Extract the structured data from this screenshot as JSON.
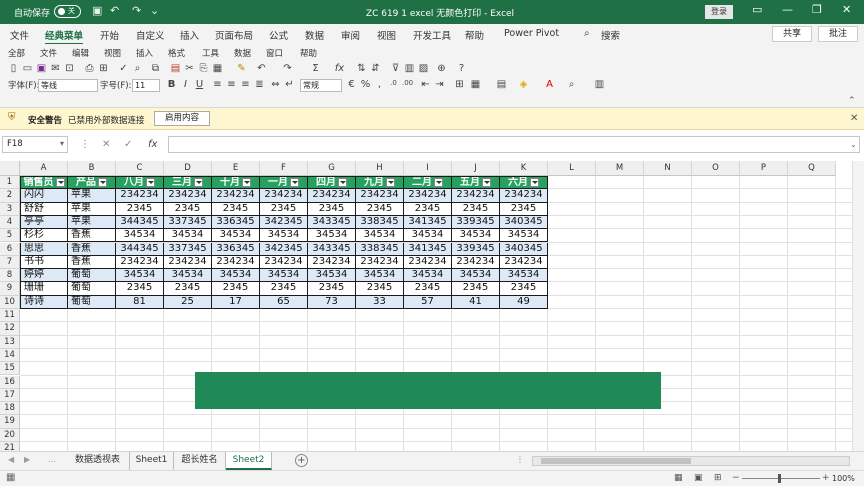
{
  "titlebar": {
    "autosave": "自动保存",
    "autosave_state": "关",
    "title": "ZC 619 1 excel 无颜色打印 - Excel",
    "login": "登录"
  },
  "menubar": {
    "tabs": [
      "文件",
      "经典菜单",
      "开始",
      "自定义",
      "插入",
      "页面布局",
      "公式",
      "数据",
      "审阅",
      "视图",
      "开发工具",
      "帮助",
      "Power Pivot"
    ],
    "search": "搜索",
    "share": "共享",
    "comments": "批注"
  },
  "ribbon": {
    "menus": [
      "全部",
      "文件",
      "编辑",
      "视图",
      "插入",
      "格式",
      "工具",
      "数据",
      "窗口",
      "帮助"
    ],
    "font_label": "字体(F):",
    "font_value": "等线",
    "size_label": "字号(F):",
    "size_value": "11",
    "number_format": "常规"
  },
  "security": {
    "title": "安全警告",
    "message": "已禁用外部数据连接",
    "button": "启用内容"
  },
  "formula_bar": {
    "name_box": "F18",
    "fx": "fx",
    "formula": ""
  },
  "columns": [
    "A",
    "B",
    "C",
    "D",
    "E",
    "F",
    "G",
    "H",
    "I",
    "J",
    "K",
    "L",
    "M",
    "N",
    "O",
    "P",
    "Q"
  ],
  "rows": [
    "1",
    "2",
    "3",
    "4",
    "5",
    "6",
    "7",
    "8",
    "9",
    "10",
    "11",
    "12",
    "13",
    "14",
    "15",
    "16",
    "17",
    "18",
    "19",
    "20",
    "21"
  ],
  "table": {
    "headers": [
      "销售员",
      "产品",
      "八月",
      "三月",
      "十月",
      "一月",
      "四月",
      "九月",
      "二月",
      "五月",
      "六月"
    ],
    "data": [
      [
        "闪闪",
        "苹果",
        "234234",
        "234234",
        "234234",
        "234234",
        "234234",
        "234234",
        "234234",
        "234234",
        "234234"
      ],
      [
        "舒舒",
        "苹果",
        "2345",
        "2345",
        "2345",
        "2345",
        "2345",
        "2345",
        "2345",
        "2345",
        "2345"
      ],
      [
        "亭亭",
        "苹果",
        "344345",
        "337345",
        "336345",
        "342345",
        "343345",
        "338345",
        "341345",
        "339345",
        "340345"
      ],
      [
        "杉杉",
        "香蕉",
        "34534",
        "34534",
        "34534",
        "34534",
        "34534",
        "34534",
        "34534",
        "34534",
        "34534"
      ],
      [
        "思思",
        "香蕉",
        "344345",
        "337345",
        "336345",
        "342345",
        "343345",
        "338345",
        "341345",
        "339345",
        "340345"
      ],
      [
        "书书",
        "香蕉",
        "234234",
        "234234",
        "234234",
        "234234",
        "234234",
        "234234",
        "234234",
        "234234",
        "234234"
      ],
      [
        "婷婷",
        "葡萄",
        "34534",
        "34534",
        "34534",
        "34534",
        "34534",
        "34534",
        "34534",
        "34534",
        "34534"
      ],
      [
        "珊珊",
        "葡萄",
        "2345",
        "2345",
        "2345",
        "2345",
        "2345",
        "2345",
        "2345",
        "2345",
        "2345"
      ],
      [
        "诗诗",
        "葡萄",
        "81",
        "25",
        "17",
        "65",
        "73",
        "33",
        "57",
        "41",
        "49"
      ]
    ]
  },
  "sheets": [
    "数据透视表",
    "Sheet1",
    "超长姓名",
    "Sheet2"
  ],
  "active_sheet": "Sheet2",
  "status": {
    "zoom": "100%"
  },
  "colors": {
    "titlebar": "#1f7145",
    "table_header": "#27a160",
    "band_row": "#dde9f6",
    "overlay_bar": "#1f8a58"
  }
}
